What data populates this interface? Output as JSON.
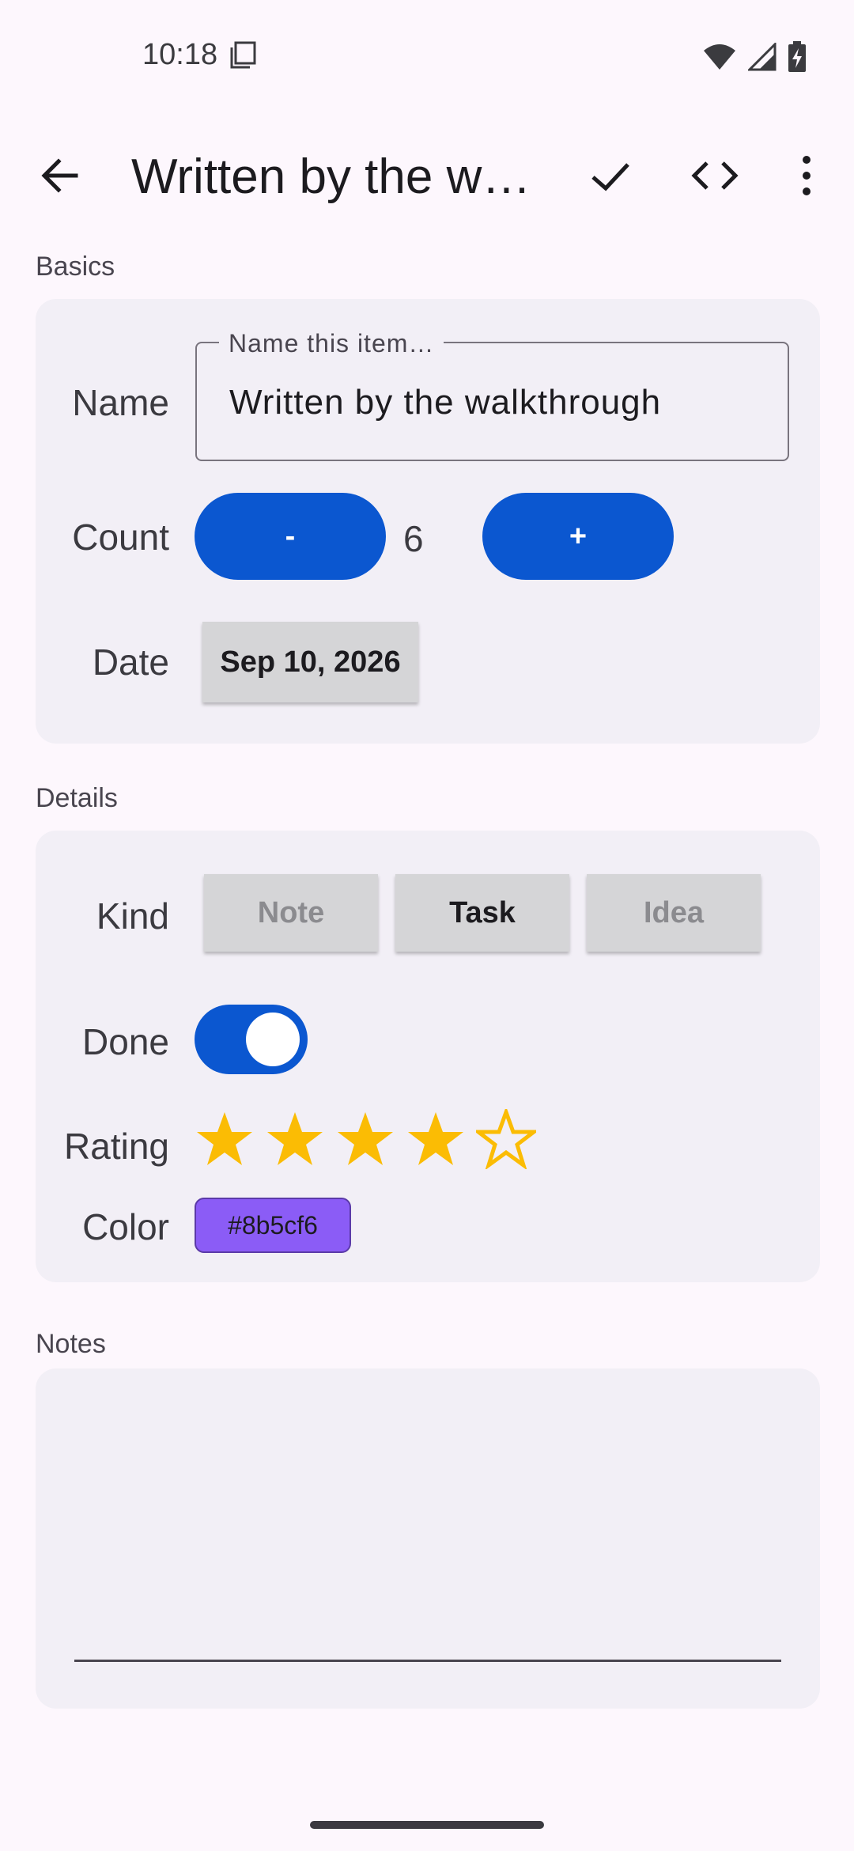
{
  "status_bar": {
    "time": "10:18"
  },
  "app_bar": {
    "title": "Written by the walkthrough"
  },
  "sections": {
    "basics": "Basics",
    "details": "Details",
    "notes": "Notes"
  },
  "basics": {
    "name_label": "Name",
    "name_field_label": "Name this item…",
    "name_value": "Written by the walkthrough",
    "count_label": "Count",
    "decrement_label": "-",
    "count_value": "6",
    "increment_label": "+",
    "date_label": "Date",
    "date_value": "Sep 10, 2026"
  },
  "details": {
    "kind_label": "Kind",
    "kind_options": [
      "Note",
      "Task",
      "Idea"
    ],
    "kind_selected": "Task",
    "done_label": "Done",
    "done_on": true,
    "rating_label": "Rating",
    "rating_value": 4,
    "rating_max": 5,
    "color_label": "Color",
    "color_value": "#8b5cf6"
  },
  "colors": {
    "accent": "#0b57d0",
    "star": "#fbbc04",
    "card": "#f2eff6",
    "background": "#fdf7fd"
  }
}
